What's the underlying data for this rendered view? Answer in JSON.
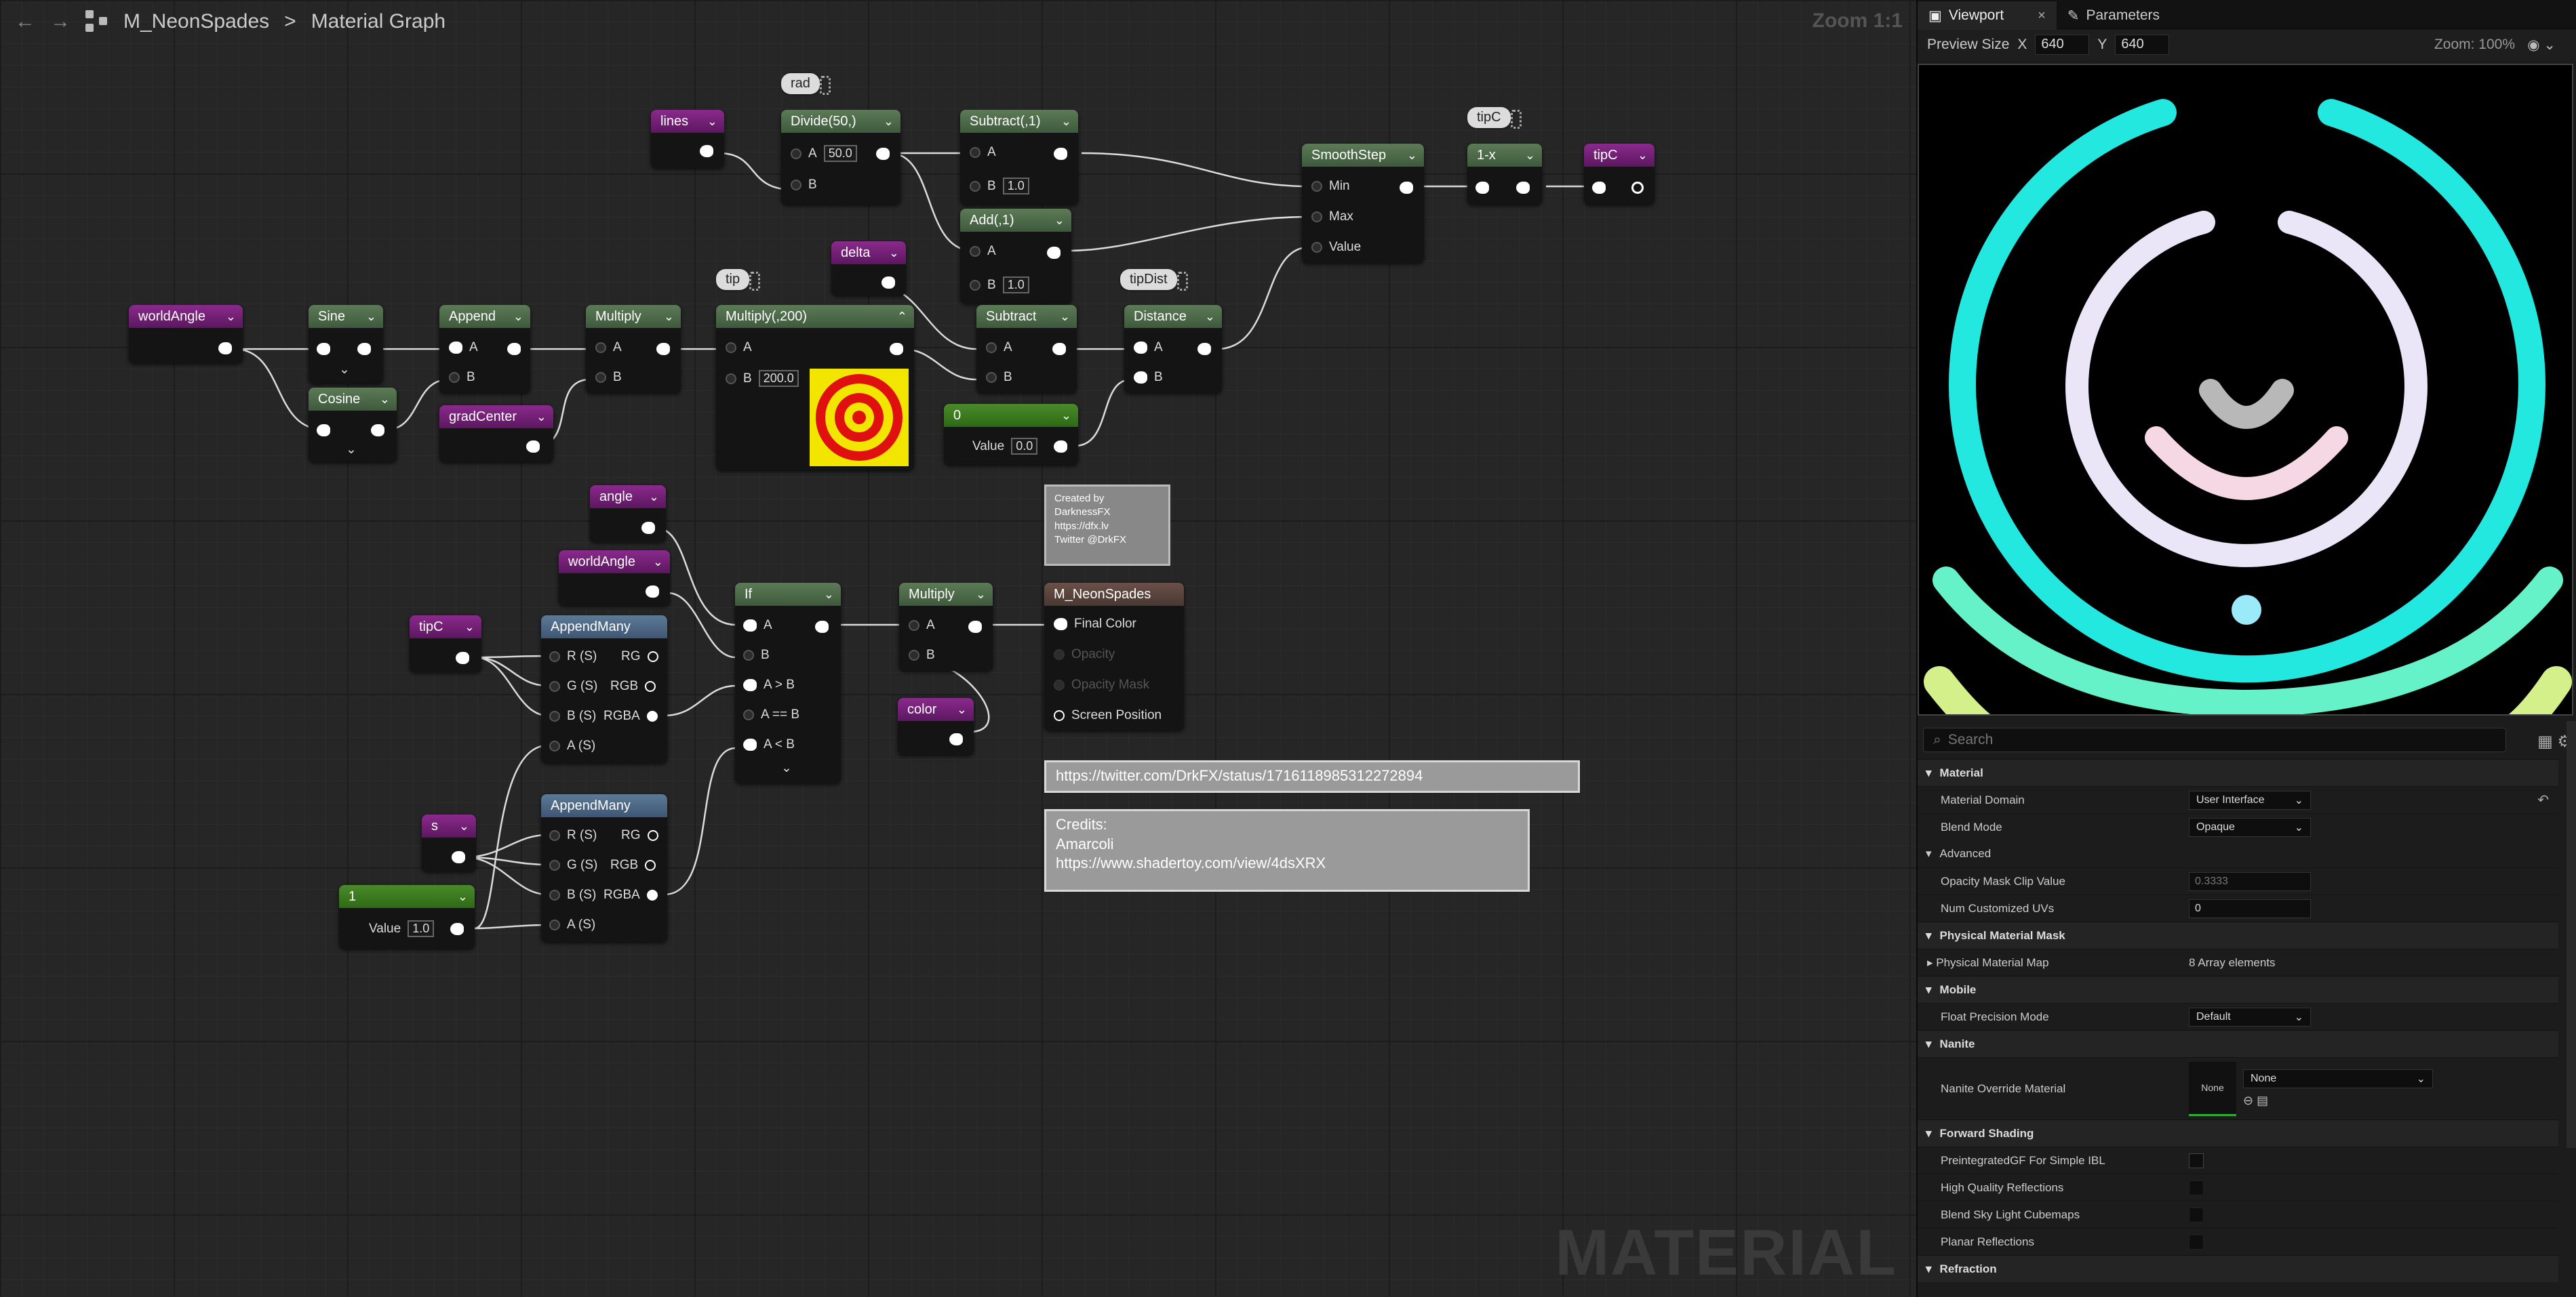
{
  "topbar": {
    "back": "←",
    "forward": "→",
    "asset": "M_NeonSpades",
    "separator": ">",
    "graph": "Material Graph",
    "zoom": "Zoom 1:1"
  },
  "watermark": "MATERIAL",
  "nodes": {
    "worldAngle1": "worldAngle",
    "sine": "Sine",
    "cosine": "Cosine",
    "append": "Append",
    "gradCenter": "gradCenter",
    "multiply1": "Multiply",
    "multiply200": "Multiply(,200)",
    "multiply200_b": "200.0",
    "lines": "lines",
    "divide": "Divide(50,)",
    "divide_a": "50.0",
    "subtract1": "Subtract(,1)",
    "subtract1_b": "1.0",
    "add1": "Add(,1)",
    "add1_b": "1.0",
    "delta": "delta",
    "subtract": "Subtract",
    "const0": "0",
    "const0_val": "0.0",
    "distance": "Distance",
    "smoothstep": "SmoothStep",
    "oneminus": "1-x",
    "tipC_out": "tipC",
    "angle": "angle",
    "worldAngle2": "worldAngle",
    "tipC_in": "tipC",
    "appendmany1": "AppendMany",
    "appendmany2": "AppendMany",
    "s": "s",
    "const1": "1",
    "const1_val": "1.0",
    "if": "If",
    "multiply2": "Multiply",
    "color": "color",
    "result": "M_NeonSpades"
  },
  "pins": {
    "A": "A",
    "B": "B",
    "Min": "Min",
    "Max": "Max",
    "Value": "Value",
    "RS": "R (S)",
    "GS": "G (S)",
    "BS": "B (S)",
    "AS": "A (S)",
    "RG": "RG",
    "RGB": "RGB",
    "RGBA": "RGBA",
    "AgtB": "A > B",
    "AeqB": "A == B",
    "AltB": "A < B",
    "finalColor": "Final Color",
    "opacity": "Opacity",
    "opacityMask": "Opacity Mask",
    "screenPos": "Screen Position"
  },
  "bubbles": {
    "rad": "rad",
    "tip": "tip",
    "tipDist": "tipDist",
    "tipC": "tipC"
  },
  "comments": {
    "credit_small": [
      "Created by",
      "DarknessFX",
      "https://dfx.lv",
      "Twitter @DrkFX"
    ],
    "twitter": "https://twitter.com/DrkFX/status/1716118985312272894",
    "credits": [
      "Credits:",
      " Amarcoli",
      "https://www.shadertoy.com/view/4dsXRX"
    ]
  },
  "panel": {
    "tab_viewport": "Viewport",
    "tab_close": "×",
    "tab_parameters": "Parameters",
    "preview_size": "Preview Size",
    "x_label": "X",
    "x_value": "640",
    "y_label": "Y",
    "y_value": "640",
    "zoom": "Zoom: 100%",
    "search_placeholder": "Search",
    "material": "Material",
    "material_domain": "Material Domain",
    "material_domain_val": "User Interface",
    "blend_mode": "Blend Mode",
    "blend_mode_val": "Opaque",
    "advanced": "Advanced",
    "opacity_clip": "Opacity Mask Clip Value",
    "opacity_clip_val": "0.3333",
    "num_uvs": "Num Customized UVs",
    "num_uvs_val": "0",
    "phys_mask": "Physical Material Mask",
    "phys_map": "Physical Material Map",
    "phys_map_val": "8 Array elements",
    "mobile": "Mobile",
    "float_precision": "Float Precision Mode",
    "float_precision_val": "Default",
    "nanite": "Nanite",
    "nanite_override": "Nanite Override Material",
    "nanite_thumb": "None",
    "nanite_val": "None",
    "forward": "Forward Shading",
    "preintegrated": "PreintegratedGF For Simple IBL",
    "hq_reflections": "High Quality Reflections",
    "blend_sky": "Blend Sky Light Cubemaps",
    "planar": "Planar Reflections",
    "refraction": "Refraction"
  },
  "colors": {
    "cyan": "#22e8e0",
    "lavender": "#eae6f8",
    "pink": "#f5d8e4",
    "grey": "#b8b8b8",
    "dot": "#9beafa",
    "lime": "#d4f08a",
    "mint": "#66f2c8"
  }
}
